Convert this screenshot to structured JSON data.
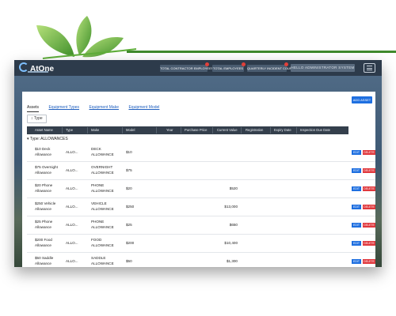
{
  "header": {
    "brand": "AtOne",
    "buttons": [
      "TOTAL CONTRACTOR EMPLOYEES",
      "TOTAL EMPLOYEES",
      "QUARTERLY INCIDENT COUNT"
    ],
    "user_label": "HELLO ADMINISTRATOR SYSTEM"
  },
  "tabs": [
    "Assets",
    "Equipment Types",
    "Equipment Make",
    "Equipment Model"
  ],
  "add_button": "ADD ASSET",
  "filter_chip": "Type",
  "columns": [
    "Asset Name",
    "Type",
    "Make",
    "Model",
    "Year",
    "Purchase Price",
    "Current Value",
    "Registration",
    "Expiry Date",
    "Inspection Due Date"
  ],
  "group_label": "Type: ALLOWANCES",
  "rows": [
    {
      "name": "$10 Deck Allowance",
      "type": "ALLO...",
      "make": "DECK ALLOWANCE",
      "model": "$10",
      "current_value": ""
    },
    {
      "name": "$75 Overnight Allowance",
      "type": "ALLO...",
      "make": "OVERNIGHT ALLOWANCE",
      "model": "$75",
      "current_value": ""
    },
    {
      "name": "$20 Phone Allowance",
      "type": "ALLO...",
      "make": "PHONE ALLOWANCE",
      "model": "$20",
      "current_value": "$520"
    },
    {
      "name": "$250 Vehicle Allowance",
      "type": "ALLO...",
      "make": "VEHICLE ALLOWANCE",
      "model": "$250",
      "current_value": "$13,000"
    },
    {
      "name": "$25 Phone Allowance",
      "type": "ALLO...",
      "make": "PHONE ALLOWANCE",
      "model": "$25",
      "current_value": "$650"
    },
    {
      "name": "$200 Food Allowance",
      "type": "ALLO...",
      "make": "FOOD ALLOWANCE",
      "model": "$200",
      "current_value": "$10,400"
    },
    {
      "name": "$50 Saddle Allowance",
      "type": "ALLO...",
      "make": "SADDLE ALLOWANCE",
      "model": "$50",
      "current_value": "$1,300"
    }
  ],
  "row_actions": {
    "edit": "EDIT",
    "delete": "DELETE"
  },
  "colors": {
    "leaf": "#5fae3a",
    "accent_line": "#3f8a2c",
    "topbar": "#2d3b4b",
    "primary": "#1e6fe0",
    "danger": "#e0383d"
  }
}
